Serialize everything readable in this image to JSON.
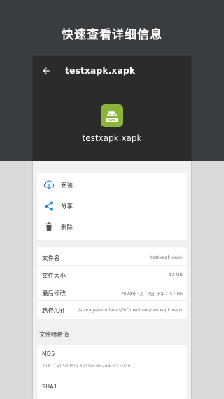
{
  "promo": {
    "title": "快速查看详细信息"
  },
  "appbar": {
    "title": "testxapk.xapk",
    "back_icon": "arrow-left-icon"
  },
  "header": {
    "filename": "testxapk.xapk",
    "icon": "android-xapk-icon",
    "icon_badge": "XAPK",
    "icon_color": "#8bb539"
  },
  "actions": [
    {
      "label": "安装",
      "icon": "install-icon"
    },
    {
      "label": "分享",
      "icon": "share-icon"
    },
    {
      "label": "删除",
      "icon": "trash-icon"
    }
  ],
  "info": [
    {
      "key": "文件名",
      "value": "testxapk.xapk"
    },
    {
      "key": "文件大小",
      "value": "142 MB"
    },
    {
      "key": "最后修改",
      "value": "2024年3月12日 下午2:57:06"
    },
    {
      "key": "路径/Uri",
      "value": "/storage/emulated/0/Download/testxapk.xapk"
    }
  ],
  "hash_section": {
    "title": "文件哈希值",
    "items": [
      {
        "label": "MD5",
        "value": "21811a13ffd59c5e390b7ca84c921b09"
      },
      {
        "label": "SHA1",
        "value": ""
      }
    ]
  },
  "colors": {
    "accent": "#1e88e5",
    "dark_bg": "#3a3d40",
    "header_bg": "#2b2b2b"
  }
}
